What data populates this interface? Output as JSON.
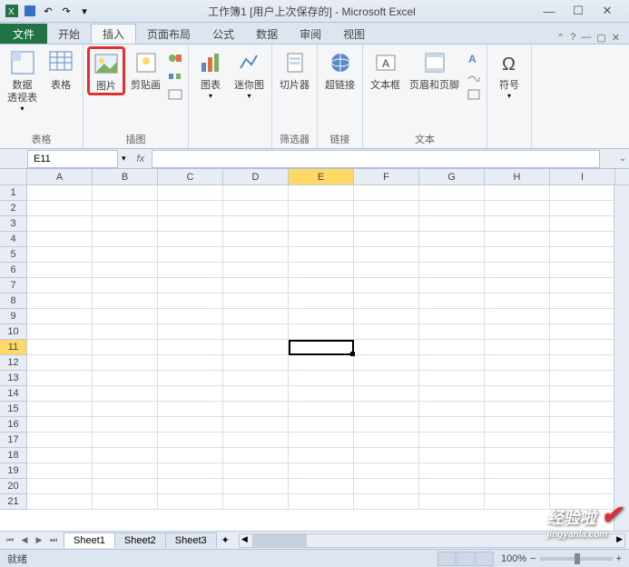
{
  "titlebar": {
    "title": "工作簿1 [用户上次保存的] - Microsoft Excel"
  },
  "tabs": {
    "file": "文件",
    "items": [
      "开始",
      "插入",
      "页面布局",
      "公式",
      "数据",
      "审阅",
      "视图"
    ],
    "active_index": 1
  },
  "ribbon": {
    "groups": [
      {
        "label": "表格",
        "buttons": [
          {
            "label": "数据\n透视表"
          },
          {
            "label": "表格"
          }
        ]
      },
      {
        "label": "插图",
        "buttons": [
          {
            "label": "图片"
          },
          {
            "label": "剪贴画"
          }
        ]
      },
      {
        "label": "",
        "buttons": [
          {
            "label": "图表"
          },
          {
            "label": "迷你图"
          }
        ]
      },
      {
        "label": "筛选器",
        "buttons": [
          {
            "label": "切片器"
          }
        ]
      },
      {
        "label": "链接",
        "buttons": [
          {
            "label": "超链接"
          }
        ]
      },
      {
        "label": "文本",
        "buttons": [
          {
            "label": "文本框"
          },
          {
            "label": "页眉和页脚"
          }
        ]
      },
      {
        "label": "",
        "buttons": [
          {
            "label": "符号"
          }
        ]
      }
    ]
  },
  "formula": {
    "name_box": "E11",
    "fx": "fx"
  },
  "grid": {
    "columns": [
      "A",
      "B",
      "C",
      "D",
      "E",
      "F",
      "G",
      "H",
      "I"
    ],
    "rows": [
      1,
      2,
      3,
      4,
      5,
      6,
      7,
      8,
      9,
      10,
      11,
      12,
      13,
      14,
      15,
      16,
      17,
      18,
      19,
      20,
      21
    ],
    "active_col": "E",
    "active_row": 11
  },
  "sheets": {
    "tabs": [
      "Sheet1",
      "Sheet2",
      "Sheet3"
    ],
    "active_index": 0
  },
  "status": {
    "ready": "就绪",
    "zoom": "100%",
    "minus": "−",
    "plus": "+"
  },
  "watermark": {
    "main": "经验啦",
    "sub": "jingyanla.com"
  }
}
